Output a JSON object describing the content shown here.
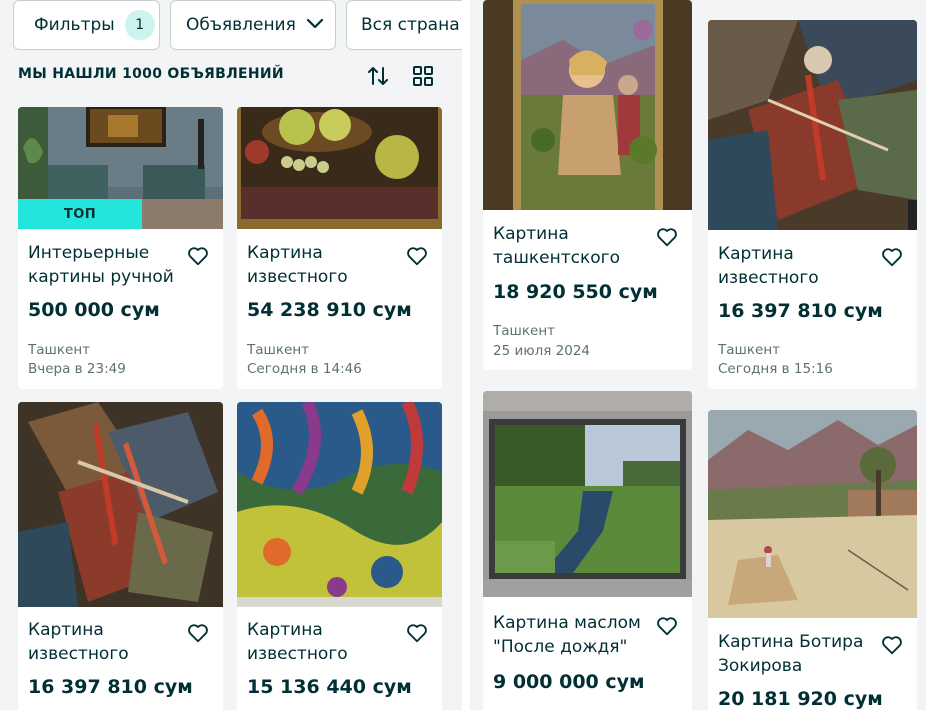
{
  "filters": {
    "filters_label": "Фильтры",
    "filters_count": "1",
    "ads_label": "Объявления",
    "region_label": "Вся страна"
  },
  "results": {
    "found_label": "МЫ НАШЛИ 1000 ОБЪЯВЛЕНИЙ",
    "sort_icon": "sort-arrows-icon",
    "view_icon": "grid-view-icon"
  },
  "colors": {
    "accent": "#23e5db",
    "text": "#002f34",
    "muted": "#5d7174",
    "badge": "#cdf3ef"
  },
  "left_cards": [
    {
      "title": "Интерьерные картины ручной",
      "price": "500 000 сум",
      "city": "Ташкент",
      "time": "Вчера в 23:49",
      "badge": "ТОП"
    },
    {
      "title": "Картина известного",
      "price": "54 238 910 сум",
      "city": "Ташкент",
      "time": "Сегодня в 14:46"
    },
    {
      "title": "Картина известного",
      "price": "16 397 810 сум"
    },
    {
      "title": "Картина известного",
      "price": "15 136 440 сум"
    }
  ],
  "right_cards": [
    {
      "title": "Картина ташкентского",
      "price": "18 920 550 сум",
      "city": "Ташкент",
      "time": "25 июля 2024"
    },
    {
      "title": "Картина известного",
      "price": "16 397 810 сум",
      "city": "Ташкент",
      "time": "Сегодня в 15:16"
    },
    {
      "title": "Картина маслом \"После дождя\"",
      "price": "9 000 000 сум"
    },
    {
      "title": "Картина Ботира Зокирова",
      "price": "20 181 920 сум"
    }
  ]
}
